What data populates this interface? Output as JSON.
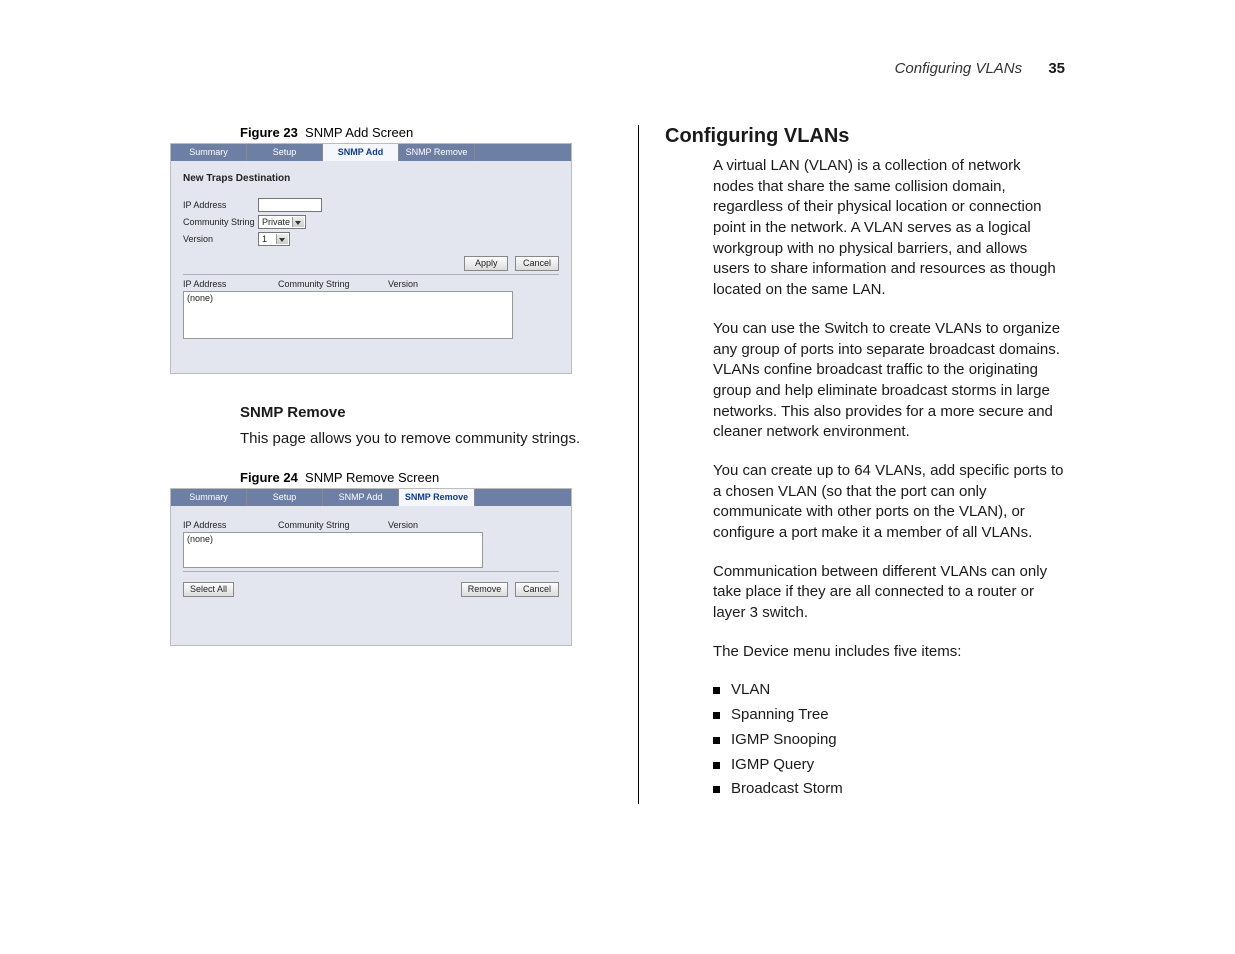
{
  "header": {
    "running_title": "Configuring VLANs",
    "page_number": "35"
  },
  "figure23": {
    "caption_bold": "Figure 23",
    "caption_rest": "SNMP Add Screen",
    "tabs": {
      "summary": "Summary",
      "setup": "Setup",
      "snmp_add": "SNMP Add",
      "snmp_remove": "SNMP Remove"
    },
    "section_title": "New Traps Destination",
    "labels": {
      "ip": "IP Address",
      "community": "Community String",
      "version": "Version"
    },
    "values": {
      "community_select": "Private",
      "version_select": "1"
    },
    "buttons": {
      "apply": "Apply",
      "cancel": "Cancel"
    },
    "table_headers": {
      "ip": "IP Address",
      "community": "Community String",
      "version": "Version"
    },
    "list_placeholder": "(none)"
  },
  "snmp_remove_section": {
    "heading": "SNMP Remove",
    "paragraph": "This page allows you to remove community strings."
  },
  "figure24": {
    "caption_bold": "Figure 24",
    "caption_rest": "SNMP Remove Screen",
    "tabs": {
      "summary": "Summary",
      "setup": "Setup",
      "snmp_add": "SNMP Add",
      "snmp_remove": "SNMP Remove"
    },
    "table_headers": {
      "ip": "IP Address",
      "community": "Community String",
      "version": "Version"
    },
    "list_placeholder": "(none)",
    "buttons": {
      "select_all": "Select All",
      "remove": "Remove",
      "cancel": "Cancel"
    }
  },
  "right": {
    "heading": "Configuring VLANs",
    "p1": "A virtual LAN (VLAN) is a collection of network nodes that share the same collision domain, regardless of their physical location or connection point in the network. A VLAN serves as a logical workgroup with no physical barriers, and allows users to share information and resources as though located on the same LAN.",
    "p2": "You can use the Switch to create VLANs to organize any group of ports into separate broadcast domains. VLANs confine broadcast traffic to the originating group and help eliminate broadcast storms in large networks. This also provides for a more secure and cleaner network environment.",
    "p3": "You can create up to 64 VLANs, add specific ports to a chosen VLAN (so that the port can only communicate with other ports on the VLAN), or configure a port make it a member of all VLANs.",
    "p4": "Communication between different VLANs can only take place if they are all connected to a router or layer 3 switch.",
    "p5": "The Device menu includes five items:",
    "items": [
      "VLAN",
      "Spanning Tree",
      "IGMP Snooping",
      "IGMP Query",
      "Broadcast Storm"
    ]
  }
}
